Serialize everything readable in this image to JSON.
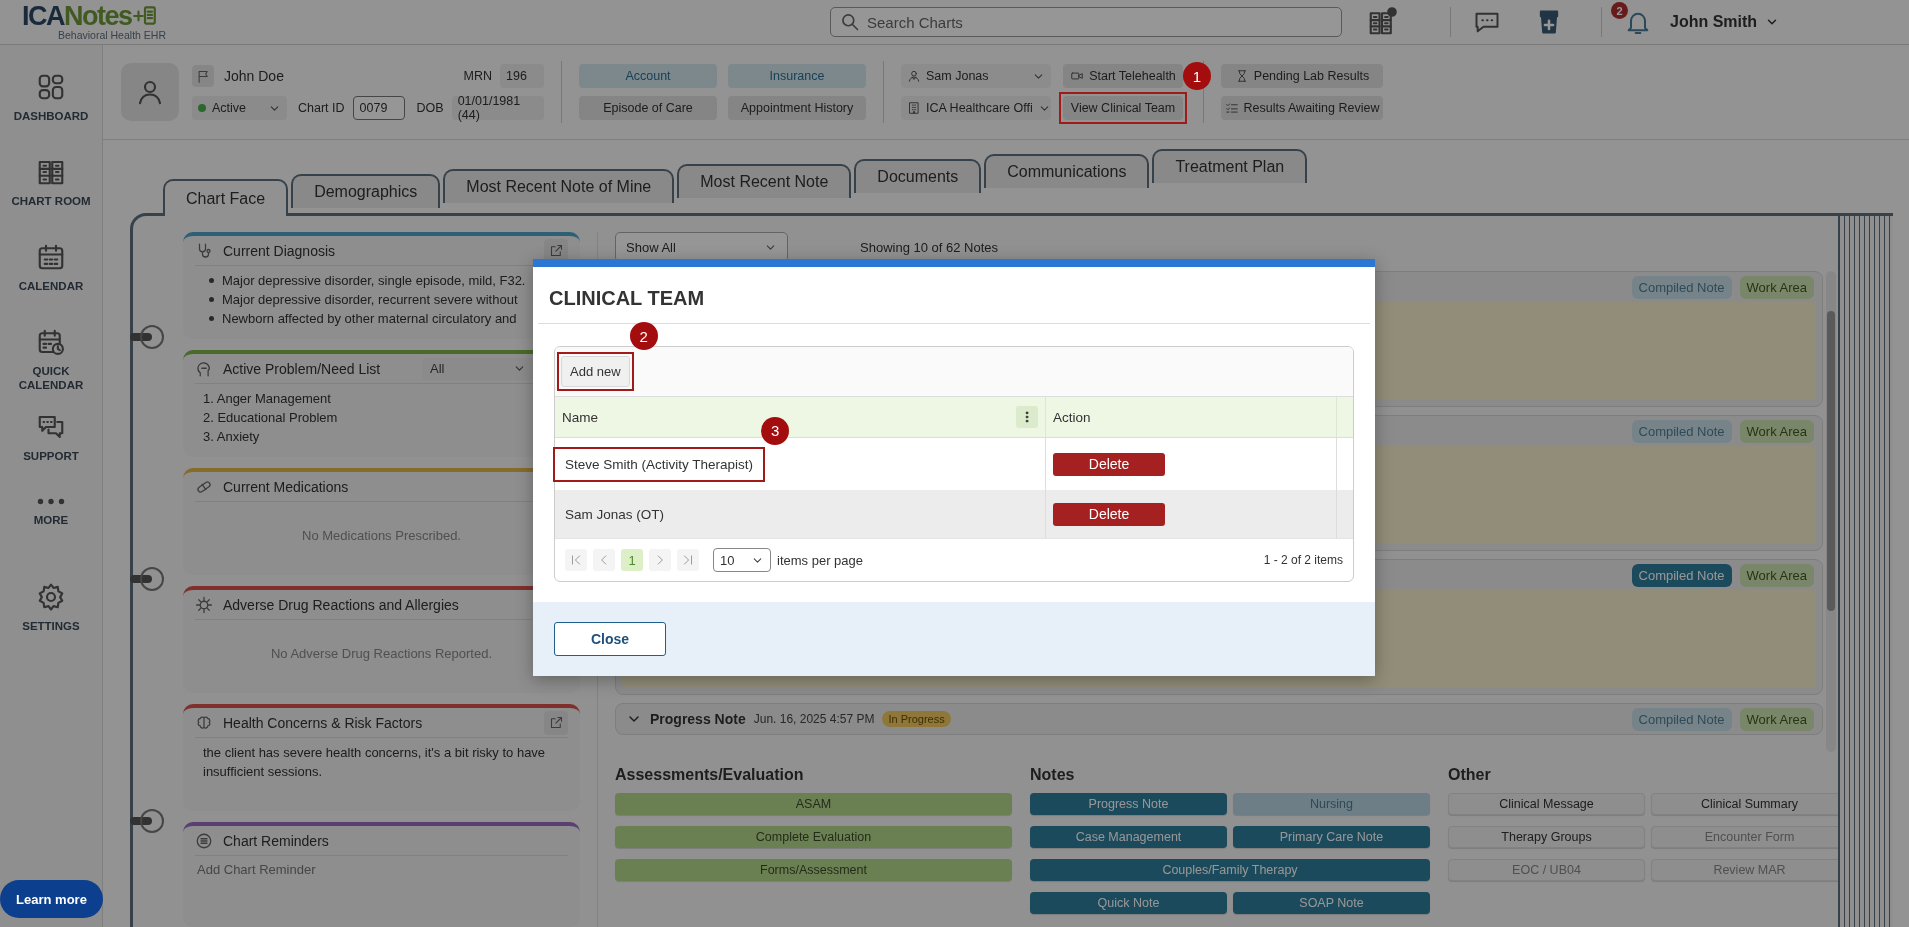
{
  "header": {
    "logo_parts": [
      "ICA",
      "Notes"
    ],
    "tagline": "Behavioral Health EHR",
    "search": {
      "placeholder": "Search Charts"
    },
    "notification_count": "2",
    "user": "John Smith"
  },
  "sidebar": {
    "items": [
      {
        "label": "DASHBOARD",
        "kind": "dashboard"
      },
      {
        "label": "CHART ROOM",
        "kind": "cabinet"
      },
      {
        "label": "CALENDAR",
        "kind": "calendar"
      },
      {
        "label": "QUICK CALENDAR",
        "kind": "quick_calendar"
      },
      {
        "label": "SUPPORT",
        "kind": "support"
      },
      {
        "label": "MORE",
        "kind": "more"
      },
      {
        "label": "SETTINGS",
        "kind": "settings"
      }
    ],
    "learn_more": "Learn more"
  },
  "patient": {
    "name": "John Doe",
    "status": "Active",
    "chart_id_label": "Chart ID",
    "chart_id": "0079",
    "mrn_label": "MRN",
    "mrn": "196",
    "dob_label": "DOB",
    "dob": "01/01/1981 (44)"
  },
  "patient_buttons": [
    {
      "label": "Account",
      "kind": "account"
    },
    {
      "label": "Insurance",
      "kind": "insurance"
    },
    {
      "label": "Episode of Care",
      "kind": "plain"
    },
    {
      "label": "Appointment History",
      "kind": "plain"
    }
  ],
  "selects": [
    {
      "value": "Sam Jonas",
      "kind": "provider"
    },
    {
      "value": "ICA Healthcare Offi",
      "kind": "location"
    }
  ],
  "actions": [
    {
      "label": "Start Telehealth",
      "kind": "telehealth"
    },
    {
      "label": "View Clinical Team",
      "kind": "plain",
      "annotation": "1"
    }
  ],
  "lab_buttons": [
    {
      "label": "Pending Lab Results",
      "kind": "hourglass"
    },
    {
      "label": "Results Awaiting Review",
      "kind": "checklist"
    }
  ],
  "tabs": [
    {
      "label": "Chart Face",
      "selected": true
    },
    {
      "label": "Demographics",
      "selected": false
    },
    {
      "label": "Most Recent Note of Mine",
      "selected": false
    },
    {
      "label": "Most Recent Note",
      "selected": false
    },
    {
      "label": "Documents",
      "selected": false
    },
    {
      "label": "Communications",
      "selected": false
    },
    {
      "label": "Treatment Plan",
      "selected": false
    }
  ],
  "cards": [
    {
      "title": "Current Diagnosis",
      "kind": "diagnosis",
      "popout": true,
      "bullets": [
        "Major depressive disorder, single episode, mild, F32.",
        "Major depressive disorder, recurrent severe without",
        "Newborn affected by other maternal circulatory and"
      ]
    },
    {
      "title": "Active Problem/Need List",
      "kind": "problems",
      "popout": false,
      "filter": "All",
      "lines": [
        "1. Anger Management",
        "2. Educational Problem",
        "3. Anxiety"
      ]
    },
    {
      "title": "Current Medications",
      "kind": "medications",
      "popout": false,
      "message": "No Medications Prescribed."
    },
    {
      "title": "Adverse Drug Reactions and Allergies",
      "kind": "reactions",
      "popout": false,
      "message": "No Adverse Drug Reactions Reported."
    },
    {
      "title": "Health Concerns & Risk Factors",
      "kind": "concerns",
      "popout": true,
      "text": "the client has severe health concerns, it's a bit risky to have insufficient sessions."
    },
    {
      "title": "Chart Reminders",
      "kind": "reminders",
      "popout": false,
      "placeholder": "Add Chart Reminder"
    }
  ],
  "notes": {
    "filter": "Show All",
    "count_text": "Showing 10 of 62 Notes",
    "items": [
      {
        "expanded": true,
        "compiled_label": "Compiled Note",
        "compiled_active": false,
        "work_area": "Work Area"
      },
      {
        "expanded": true,
        "compiled_label": "Compiled Note",
        "compiled_active": false,
        "work_area": "Work Area"
      },
      {
        "expanded": true,
        "compiled_label": "Compiled Note",
        "compiled_active": true,
        "work_area": "Work Area"
      },
      {
        "expanded": false,
        "title": "Progress Note",
        "date": "Jun. 16, 2025 4:57 PM",
        "status": "In Progress",
        "compiled_label": "Compiled Note",
        "compiled_active": false,
        "work_area": "Work Area"
      }
    ]
  },
  "quick_groups": [
    {
      "title": "Assessments/Evaluation",
      "kind": "assessment",
      "buttons": [
        {
          "label": "ASAM",
          "disabled": false,
          "wide": true
        },
        {
          "label": "Complete Evaluation",
          "disabled": false,
          "wide": true
        },
        {
          "label": "Forms/Assessment",
          "disabled": false,
          "wide": true
        }
      ]
    },
    {
      "title": "Notes",
      "kind": "note",
      "buttons": [
        {
          "label": "Progress Note",
          "disabled": false,
          "wide": false
        },
        {
          "label": "Nursing",
          "disabled": true,
          "wide": false
        },
        {
          "label": "Case Management",
          "disabled": false,
          "wide": false
        },
        {
          "label": "Primary Care Note",
          "disabled": false,
          "wide": false
        },
        {
          "label": "Couples/Family Therapy",
          "disabled": false,
          "wide": true
        },
        {
          "label": "Quick Note",
          "disabled": false,
          "wide": false
        },
        {
          "label": "SOAP Note",
          "disabled": false,
          "wide": false
        }
      ]
    },
    {
      "title": "Other",
      "kind": "other",
      "buttons": [
        {
          "label": "Clinical Message",
          "disabled": false,
          "wide": false
        },
        {
          "label": "Clinical Summary",
          "disabled": false,
          "wide": false
        },
        {
          "label": "Therapy Groups",
          "disabled": false,
          "wide": false
        },
        {
          "label": "Encounter Form",
          "disabled": true,
          "wide": false
        },
        {
          "label": "EOC / UB04",
          "disabled": true,
          "wide": false
        },
        {
          "label": "Review MAR",
          "disabled": true,
          "wide": false
        }
      ]
    }
  ],
  "modal": {
    "title": "CLINICAL TEAM",
    "add_button": {
      "label": "Add new",
      "annotation": "2"
    },
    "columns": [
      "Name",
      "Action"
    ],
    "rows": [
      {
        "name": "Steve Smith (Activity Therapist)",
        "action": "Delete",
        "annotation": "3"
      },
      {
        "name": "Sam Jonas (OT)",
        "action": "Delete"
      }
    ],
    "pager": {
      "pages": [
        {
          "label": "1",
          "selected": true
        }
      ],
      "page_size": "10",
      "page_size_label": "items per page",
      "summary": "1 - 2 of 2 items"
    },
    "close": "Close"
  }
}
